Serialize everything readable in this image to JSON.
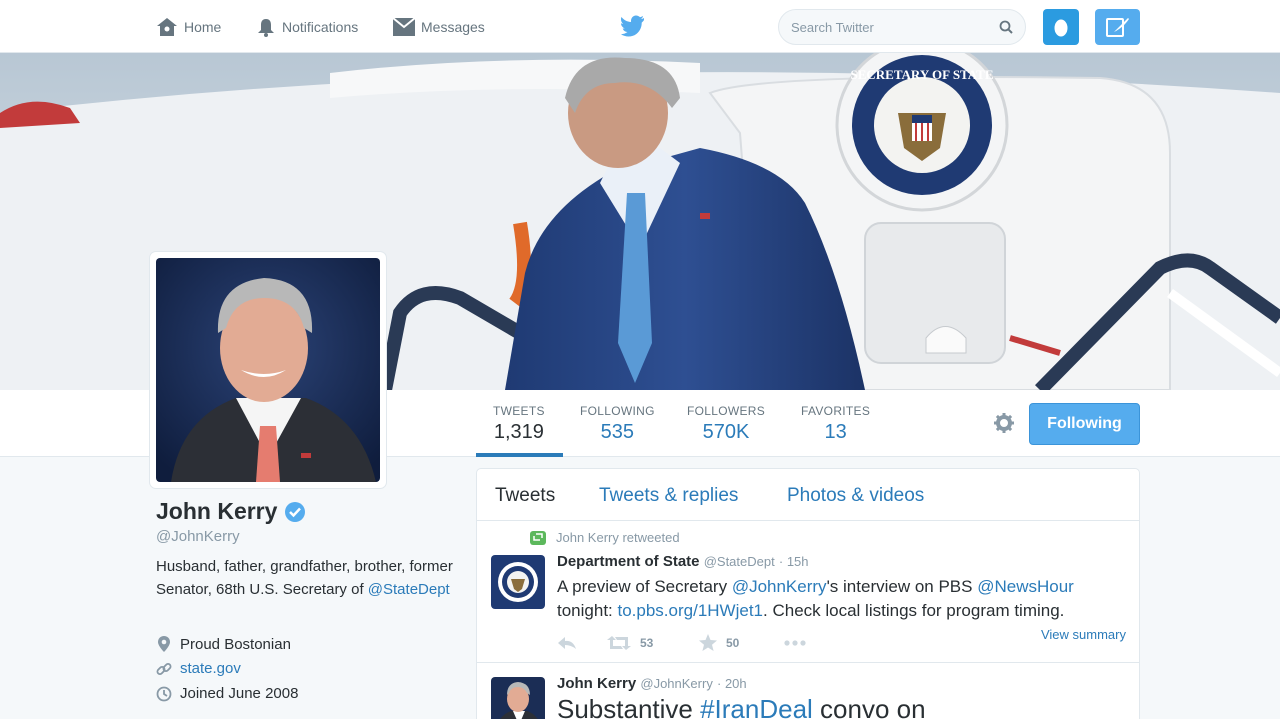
{
  "nav": {
    "home": "Home",
    "notifications": "Notifications",
    "messages": "Messages",
    "search_placeholder": "Search Twitter"
  },
  "profile": {
    "name": "John Kerry",
    "handle": "@JohnKerry",
    "bio_text": "Husband, father, grandfather, brother, former Senator, 68th U.S. Secretary of ",
    "bio_mention": "@StateDept",
    "location": "Proud Bostonian",
    "url": "state.gov",
    "joined": "Joined June 2008",
    "banner_seal_text": "SECRETARY OF STATE"
  },
  "stats": [
    {
      "label": "TWEETS",
      "value": "1,319"
    },
    {
      "label": "FOLLOWING",
      "value": "535"
    },
    {
      "label": "FOLLOWERS",
      "value": "570K"
    },
    {
      "label": "FAVORITES",
      "value": "13"
    }
  ],
  "follow_button": "Following",
  "tabs": [
    "Tweets",
    "Tweets & replies",
    "Photos & videos"
  ],
  "tweets": [
    {
      "context": "John Kerry retweeted",
      "name": "Department of State",
      "handle": "@StateDept",
      "time": "· 15h",
      "text_parts": [
        "A preview of Secretary ",
        "@JohnKerry",
        "'s interview on PBS ",
        "@NewsHour",
        " tonight: ",
        "to.pbs.org/1HWjet1",
        ". Check local listings for program timing."
      ],
      "retweets": "53",
      "favorites": "50",
      "view_summary": "View summary"
    },
    {
      "name": "John Kerry",
      "handle": "@JohnKerry",
      "time": "· 20h",
      "text_parts": [
        "Substantive ",
        "#IranDeal",
        " convo on"
      ]
    }
  ],
  "colors": {
    "accent": "#55acee",
    "link": "#2b7bb9",
    "verified": "#55acee"
  }
}
